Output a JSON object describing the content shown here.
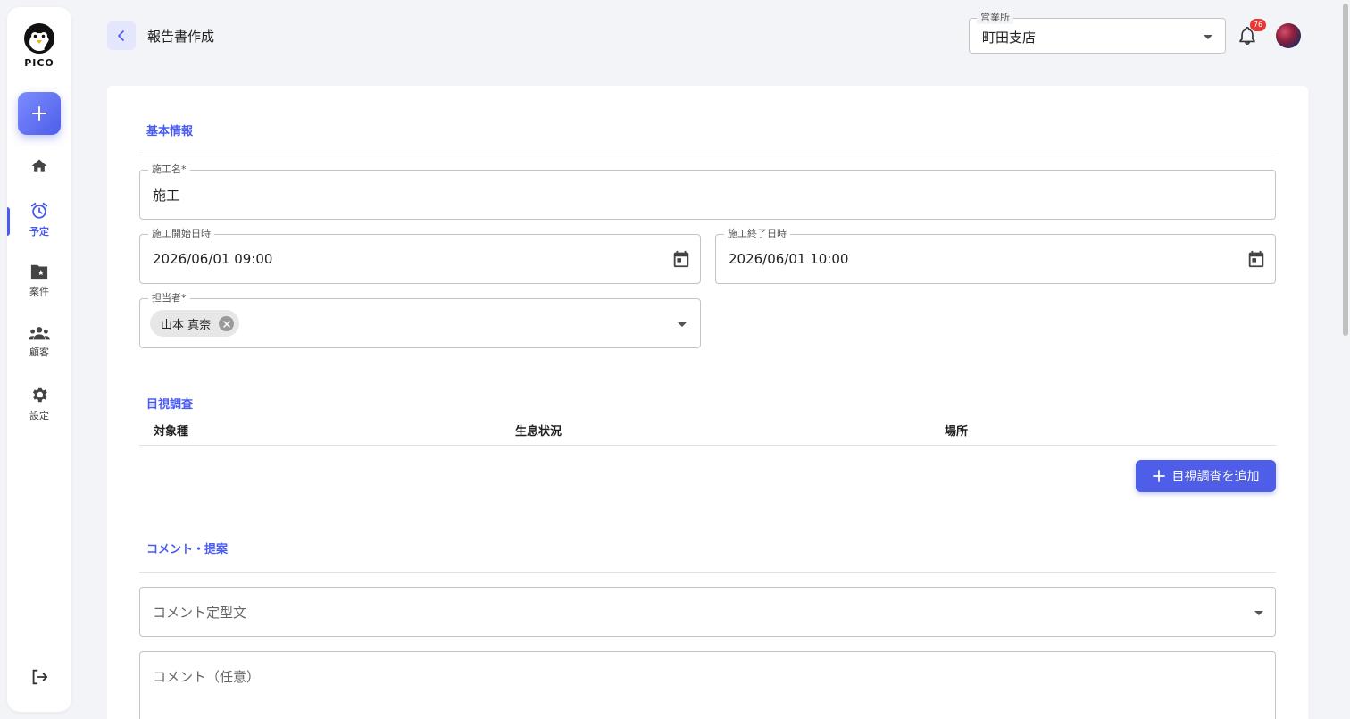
{
  "sidebar": {
    "logo_text": "PICO",
    "items": [
      {
        "label": ""
      },
      {
        "label": "予定"
      },
      {
        "label": "案件"
      },
      {
        "label": "顧客"
      },
      {
        "label": "設定"
      }
    ]
  },
  "header": {
    "title": "報告書作成",
    "branch": {
      "label": "営業所",
      "value": "町田支店"
    },
    "notification_count": "76"
  },
  "basic_info": {
    "section_title": "基本情報",
    "construction_name": {
      "label": "施工名*",
      "value": "施工"
    },
    "start": {
      "label": "施工開始日時",
      "value": "2026/06/01 09:00"
    },
    "end": {
      "label": "施工終了日時",
      "value": "2026/06/01 10:00"
    },
    "assignee": {
      "label": "担当者*",
      "chip": "山本 真奈"
    }
  },
  "visual_survey": {
    "section_title": "目視調査",
    "columns": [
      "対象種",
      "生息状況",
      "場所"
    ],
    "add_button": "目視調査を追加"
  },
  "comments": {
    "section_title": "コメント・提案",
    "template_placeholder": "コメント定型文",
    "comment_placeholder": "コメント（任意）"
  },
  "colors": {
    "accent": "#4a5cf0",
    "button": "#4e5ee8",
    "badge": "#e53935"
  }
}
